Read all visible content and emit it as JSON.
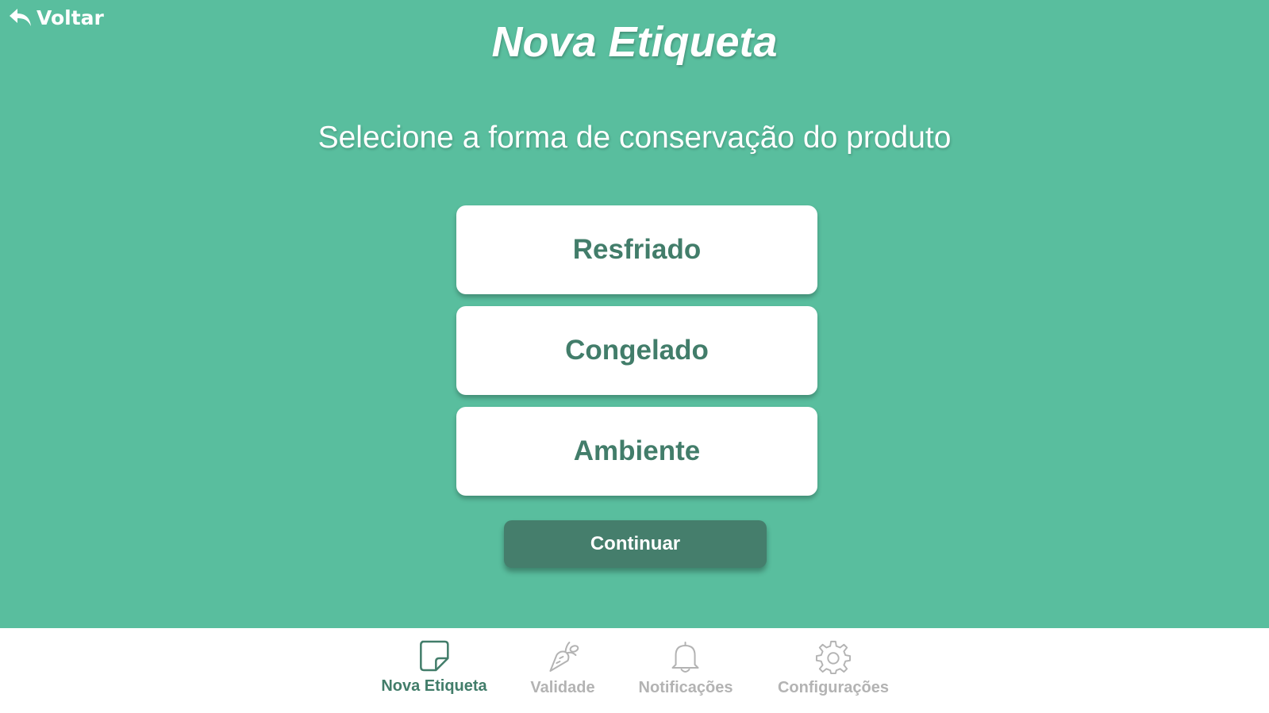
{
  "header": {
    "back_label": "Voltar",
    "title": "Nova Etiqueta"
  },
  "main": {
    "prompt": "Selecione a forma de conservação do produto",
    "options": [
      {
        "label": "Resfriado"
      },
      {
        "label": "Congelado"
      },
      {
        "label": "Ambiente"
      }
    ],
    "continue_label": "Continuar"
  },
  "nav": {
    "items": [
      {
        "label": "Nova Etiqueta",
        "icon": "sticky-note-icon",
        "active": true
      },
      {
        "label": "Validade",
        "icon": "carrot-icon",
        "active": false
      },
      {
        "label": "Notificações",
        "icon": "bell-icon",
        "active": false
      },
      {
        "label": "Configurações",
        "icon": "gear-icon",
        "active": false
      }
    ]
  },
  "colors": {
    "background": "#59be9e",
    "primary_dark": "#457e6c",
    "option_text": "#427d6a",
    "nav_inactive": "#b3b3b3"
  }
}
